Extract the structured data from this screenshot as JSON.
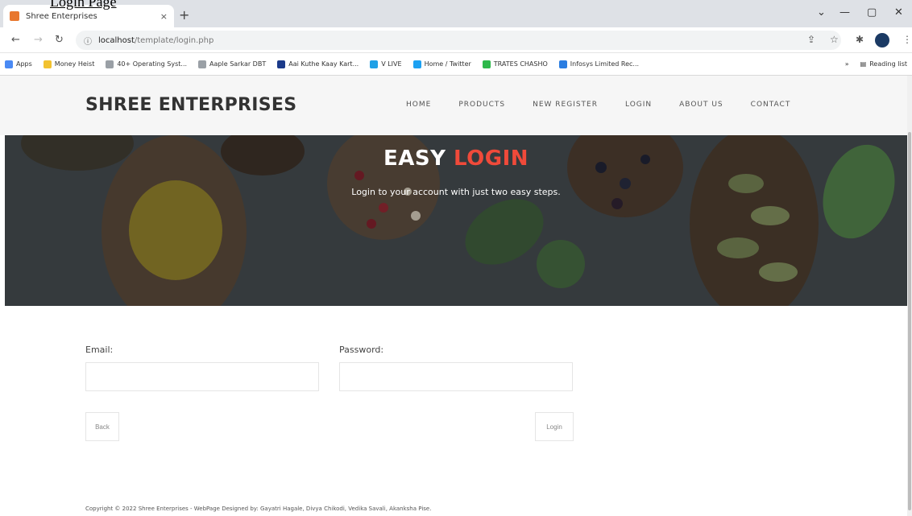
{
  "page_caption": "Login Page",
  "browser": {
    "tab_title": "Shree Enterprises",
    "tab_close": "×",
    "new_tab": "+",
    "url_host": "localhost",
    "url_path": "/template/login.php",
    "window_controls": [
      "⌄",
      "—",
      "▢",
      "✕"
    ],
    "bookmarks": [
      {
        "label": "Apps",
        "color": "#4a8af4"
      },
      {
        "label": "Money Heist",
        "color": "#f2c230"
      },
      {
        "label": "40+ Operating Syst...",
        "color": "#9aa0a6"
      },
      {
        "label": "Aaple Sarkar DBT",
        "color": "#9aa0a6"
      },
      {
        "label": "Aai Kuthe Kaay Kart...",
        "color": "#1b3a8a"
      },
      {
        "label": "V LIVE",
        "color": "#1fa0e6"
      },
      {
        "label": "Home / Twitter",
        "color": "#1da1f2"
      },
      {
        "label": "TRATES CHASHO",
        "color": "#2eb84b"
      },
      {
        "label": "Infosys Limited Rec...",
        "color": "#2a7de1"
      }
    ],
    "reading_list": "Reading list"
  },
  "site": {
    "brand": "SHREE ENTERPRISES",
    "menu": [
      "HOME",
      "PRODUCTS",
      "NEW REGISTER",
      "LOGIN",
      "ABOUT US",
      "CONTACT"
    ],
    "hero": {
      "title_plain": "EASY ",
      "title_accent": "LOGIN",
      "subtitle": "Login to your account with just two easy steps."
    },
    "form": {
      "email_label": "Email:",
      "email_value": "",
      "password_label": "Password:",
      "password_value": "",
      "back_label": "Back",
      "login_label": "Login"
    },
    "footer": "Copyright © 2022 Shree Enterprises - WebPage Designed by: Gayatri Hagale, Divya Chikodi, Vedika Savali, Akanksha Pise."
  },
  "colors": {
    "accent": "#f04a3a",
    "brand_text": "#333333"
  }
}
